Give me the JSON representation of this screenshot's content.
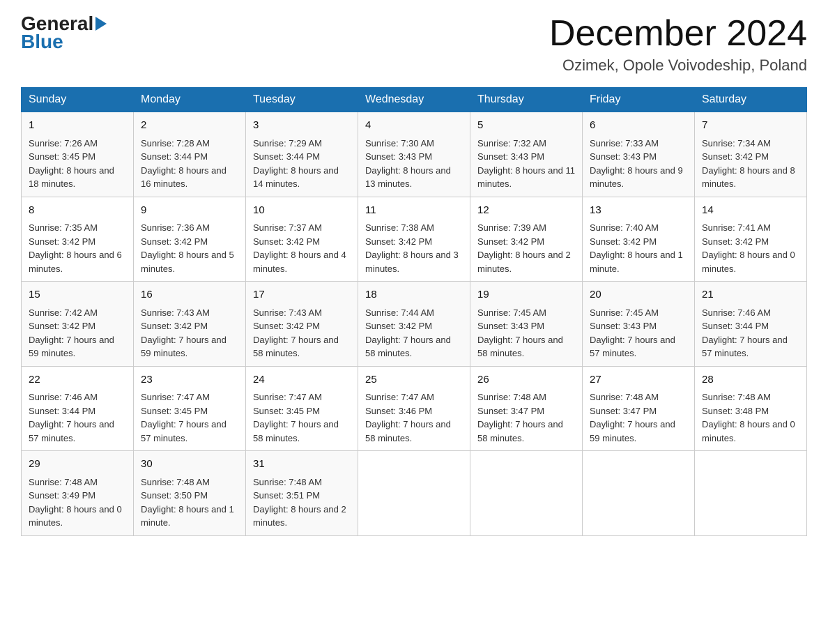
{
  "logo": {
    "general": "General",
    "arrow": "",
    "blue": "Blue"
  },
  "header": {
    "month": "December 2024",
    "location": "Ozimek, Opole Voivodeship, Poland"
  },
  "days_of_week": [
    "Sunday",
    "Monday",
    "Tuesday",
    "Wednesday",
    "Thursday",
    "Friday",
    "Saturday"
  ],
  "weeks": [
    [
      {
        "day": "1",
        "sunrise": "7:26 AM",
        "sunset": "3:45 PM",
        "daylight": "8 hours and 18 minutes."
      },
      {
        "day": "2",
        "sunrise": "7:28 AM",
        "sunset": "3:44 PM",
        "daylight": "8 hours and 16 minutes."
      },
      {
        "day": "3",
        "sunrise": "7:29 AM",
        "sunset": "3:44 PM",
        "daylight": "8 hours and 14 minutes."
      },
      {
        "day": "4",
        "sunrise": "7:30 AM",
        "sunset": "3:43 PM",
        "daylight": "8 hours and 13 minutes."
      },
      {
        "day": "5",
        "sunrise": "7:32 AM",
        "sunset": "3:43 PM",
        "daylight": "8 hours and 11 minutes."
      },
      {
        "day": "6",
        "sunrise": "7:33 AM",
        "sunset": "3:43 PM",
        "daylight": "8 hours and 9 minutes."
      },
      {
        "day": "7",
        "sunrise": "7:34 AM",
        "sunset": "3:42 PM",
        "daylight": "8 hours and 8 minutes."
      }
    ],
    [
      {
        "day": "8",
        "sunrise": "7:35 AM",
        "sunset": "3:42 PM",
        "daylight": "8 hours and 6 minutes."
      },
      {
        "day": "9",
        "sunrise": "7:36 AM",
        "sunset": "3:42 PM",
        "daylight": "8 hours and 5 minutes."
      },
      {
        "day": "10",
        "sunrise": "7:37 AM",
        "sunset": "3:42 PM",
        "daylight": "8 hours and 4 minutes."
      },
      {
        "day": "11",
        "sunrise": "7:38 AM",
        "sunset": "3:42 PM",
        "daylight": "8 hours and 3 minutes."
      },
      {
        "day": "12",
        "sunrise": "7:39 AM",
        "sunset": "3:42 PM",
        "daylight": "8 hours and 2 minutes."
      },
      {
        "day": "13",
        "sunrise": "7:40 AM",
        "sunset": "3:42 PM",
        "daylight": "8 hours and 1 minute."
      },
      {
        "day": "14",
        "sunrise": "7:41 AM",
        "sunset": "3:42 PM",
        "daylight": "8 hours and 0 minutes."
      }
    ],
    [
      {
        "day": "15",
        "sunrise": "7:42 AM",
        "sunset": "3:42 PM",
        "daylight": "7 hours and 59 minutes."
      },
      {
        "day": "16",
        "sunrise": "7:43 AM",
        "sunset": "3:42 PM",
        "daylight": "7 hours and 59 minutes."
      },
      {
        "day": "17",
        "sunrise": "7:43 AM",
        "sunset": "3:42 PM",
        "daylight": "7 hours and 58 minutes."
      },
      {
        "day": "18",
        "sunrise": "7:44 AM",
        "sunset": "3:42 PM",
        "daylight": "7 hours and 58 minutes."
      },
      {
        "day": "19",
        "sunrise": "7:45 AM",
        "sunset": "3:43 PM",
        "daylight": "7 hours and 58 minutes."
      },
      {
        "day": "20",
        "sunrise": "7:45 AM",
        "sunset": "3:43 PM",
        "daylight": "7 hours and 57 minutes."
      },
      {
        "day": "21",
        "sunrise": "7:46 AM",
        "sunset": "3:44 PM",
        "daylight": "7 hours and 57 minutes."
      }
    ],
    [
      {
        "day": "22",
        "sunrise": "7:46 AM",
        "sunset": "3:44 PM",
        "daylight": "7 hours and 57 minutes."
      },
      {
        "day": "23",
        "sunrise": "7:47 AM",
        "sunset": "3:45 PM",
        "daylight": "7 hours and 57 minutes."
      },
      {
        "day": "24",
        "sunrise": "7:47 AM",
        "sunset": "3:45 PM",
        "daylight": "7 hours and 58 minutes."
      },
      {
        "day": "25",
        "sunrise": "7:47 AM",
        "sunset": "3:46 PM",
        "daylight": "7 hours and 58 minutes."
      },
      {
        "day": "26",
        "sunrise": "7:48 AM",
        "sunset": "3:47 PM",
        "daylight": "7 hours and 58 minutes."
      },
      {
        "day": "27",
        "sunrise": "7:48 AM",
        "sunset": "3:47 PM",
        "daylight": "7 hours and 59 minutes."
      },
      {
        "day": "28",
        "sunrise": "7:48 AM",
        "sunset": "3:48 PM",
        "daylight": "8 hours and 0 minutes."
      }
    ],
    [
      {
        "day": "29",
        "sunrise": "7:48 AM",
        "sunset": "3:49 PM",
        "daylight": "8 hours and 0 minutes."
      },
      {
        "day": "30",
        "sunrise": "7:48 AM",
        "sunset": "3:50 PM",
        "daylight": "8 hours and 1 minute."
      },
      {
        "day": "31",
        "sunrise": "7:48 AM",
        "sunset": "3:51 PM",
        "daylight": "8 hours and 2 minutes."
      },
      null,
      null,
      null,
      null
    ]
  ],
  "labels": {
    "sunrise": "Sunrise:",
    "sunset": "Sunset:",
    "daylight": "Daylight:"
  }
}
